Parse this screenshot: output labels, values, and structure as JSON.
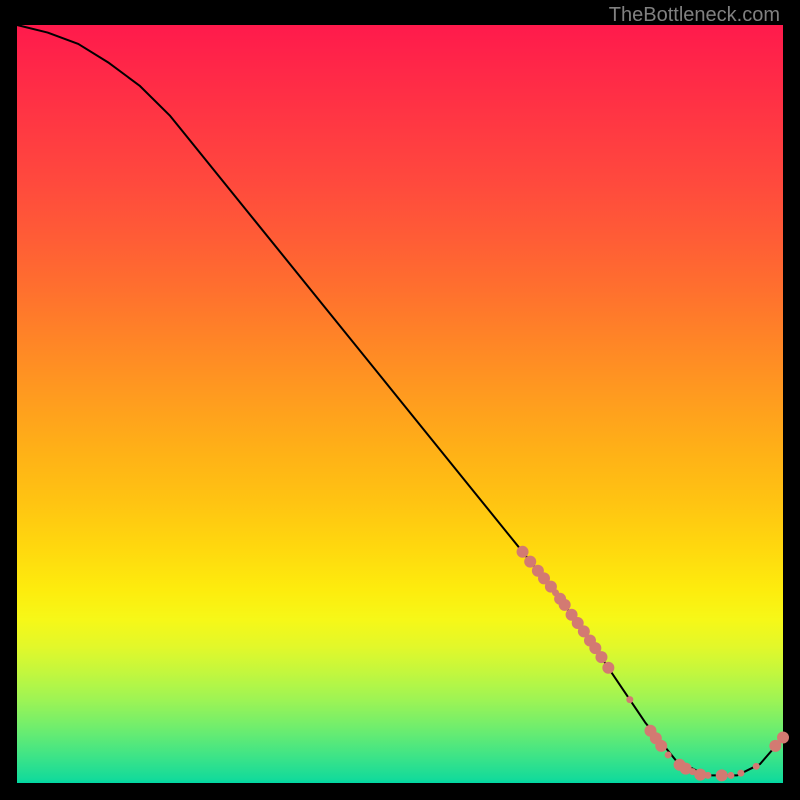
{
  "watermark": "TheBottleneck.com",
  "chart_data": {
    "type": "line",
    "title": "",
    "xlabel": "",
    "ylabel": "",
    "xlim": [
      0,
      100
    ],
    "ylim": [
      0,
      100
    ],
    "series": [
      {
        "name": "curve",
        "color": "#000000",
        "x": [
          0,
          4,
          8,
          12,
          16,
          20,
          30,
          40,
          50,
          60,
          66,
          70,
          74,
          78,
          82,
          86,
          90,
          94,
          97,
          100
        ],
        "y": [
          100,
          99,
          97.5,
          95,
          92,
          88,
          75.5,
          63,
          50.5,
          38,
          30.5,
          25.5,
          20,
          14,
          8,
          3,
          1,
          1,
          2.5,
          6
        ]
      }
    ],
    "markers": [
      {
        "name": "dots",
        "color": "#d37a72",
        "radius_large": 6,
        "radius_small": 3.5,
        "points": [
          {
            "x": 66.0,
            "y": 30.5,
            "r": "large"
          },
          {
            "x": 67.0,
            "y": 29.2,
            "r": "large"
          },
          {
            "x": 68.0,
            "y": 28.0,
            "r": "large"
          },
          {
            "x": 68.8,
            "y": 27.0,
            "r": "large"
          },
          {
            "x": 69.7,
            "y": 25.9,
            "r": "large"
          },
          {
            "x": 70.3,
            "y": 25.1,
            "r": "small"
          },
          {
            "x": 70.9,
            "y": 24.3,
            "r": "large"
          },
          {
            "x": 71.5,
            "y": 23.5,
            "r": "large"
          },
          {
            "x": 72.4,
            "y": 22.2,
            "r": "large"
          },
          {
            "x": 73.2,
            "y": 21.1,
            "r": "large"
          },
          {
            "x": 74.0,
            "y": 20.0,
            "r": "large"
          },
          {
            "x": 74.8,
            "y": 18.8,
            "r": "large"
          },
          {
            "x": 75.5,
            "y": 17.8,
            "r": "large"
          },
          {
            "x": 76.3,
            "y": 16.6,
            "r": "large"
          },
          {
            "x": 77.2,
            "y": 15.2,
            "r": "large"
          },
          {
            "x": 80.0,
            "y": 11.0,
            "r": "small"
          },
          {
            "x": 82.7,
            "y": 6.9,
            "r": "large"
          },
          {
            "x": 83.4,
            "y": 5.9,
            "r": "large"
          },
          {
            "x": 84.1,
            "y": 4.9,
            "r": "large"
          },
          {
            "x": 85.0,
            "y": 3.7,
            "r": "small"
          },
          {
            "x": 86.5,
            "y": 2.4,
            "r": "large"
          },
          {
            "x": 87.3,
            "y": 1.9,
            "r": "large"
          },
          {
            "x": 88.2,
            "y": 1.5,
            "r": "small"
          },
          {
            "x": 89.2,
            "y": 1.1,
            "r": "large"
          },
          {
            "x": 90.2,
            "y": 1.0,
            "r": "small"
          },
          {
            "x": 92.0,
            "y": 1.0,
            "r": "large"
          },
          {
            "x": 93.2,
            "y": 1.0,
            "r": "small"
          },
          {
            "x": 94.5,
            "y": 1.3,
            "r": "small"
          },
          {
            "x": 96.5,
            "y": 2.2,
            "r": "small"
          },
          {
            "x": 99.0,
            "y": 4.9,
            "r": "large"
          },
          {
            "x": 100.0,
            "y": 6.0,
            "r": "large"
          }
        ]
      }
    ]
  }
}
